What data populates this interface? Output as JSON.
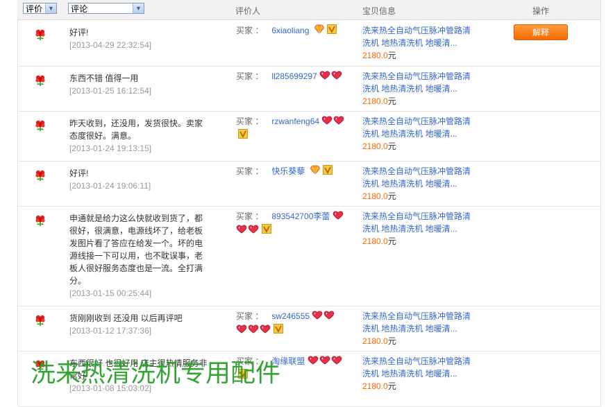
{
  "header": {
    "filter_rating": "评价",
    "filter_comment": "评论",
    "col_reviewer": "评价人",
    "col_product": "宝贝信息",
    "col_action": "操作"
  },
  "buyer_label": "买家 ：",
  "product_title": "洗来热全自动气压脉冲管路清洗机 地热清洗机 地暖清...",
  "price": "2180.0",
  "unit": "元",
  "explain_label": "解释",
  "watermark": "洗来热清洗机专用配件",
  "colors": {
    "accent": "#f46b00",
    "link": "#3366cc",
    "price": "#ff6600",
    "watermark": "#2aa02a"
  },
  "reviews": [
    {
      "comment": "好评!",
      "date": "[2013-04-29 22:32:54]",
      "buyer": "6xiaoliang",
      "hearts": 0,
      "diamond": true,
      "vbadge": true
    },
    {
      "comment": "东西不错 值得一用",
      "date": "[2013-01-25 16:12:54]",
      "buyer": "ll285699297",
      "hearts": 2,
      "diamond": false,
      "vbadge": false
    },
    {
      "comment": "昨天收到，还没用，发货很快。卖家态度很好。满意。",
      "date": "[2013-01-24 19:13:15]",
      "buyer": "rzwanfeng64",
      "hearts": 2,
      "diamond": false,
      "vbadge": true
    },
    {
      "comment": "好评!",
      "date": "[2013-01-24 19:06:11]",
      "buyer": "快乐葵藜",
      "hearts": 0,
      "diamond": true,
      "vbadge": true
    },
    {
      "comment": "申通就是给力这么快就收到货了，都很好，很满意，电源线坏了，给老板发图片看了答应在给发一个。坏的电源线接一下可以用，也不耽误事，老板人很好服务态度也是一流。全打满分。",
      "date": "[2013-01-15 00:25:44]",
      "buyer": "893542700李蕾",
      "hearts": 3,
      "diamond": false,
      "vbadge": true
    },
    {
      "comment": "货刚刚收到 还没用 以后再评吧",
      "date": "[2013-01-12 17:37:36]",
      "buyer": "sw246555",
      "hearts": 5,
      "diamond": false,
      "vbadge": true
    },
    {
      "comment": "东西很好 也很好用 店主很热情服务非常好",
      "date": "[2013-01-08 15:03:02]",
      "buyer": "淘缘联盟",
      "hearts": 3,
      "diamond": false,
      "vbadge": true
    }
  ]
}
